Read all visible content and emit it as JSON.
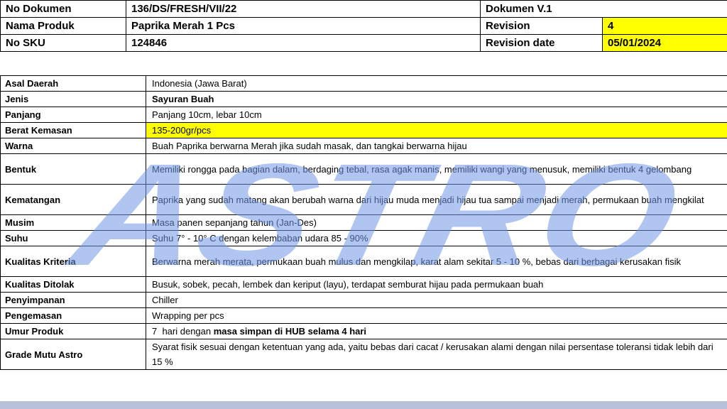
{
  "header": {
    "no_dokumen_label": "No Dokumen",
    "no_dokumen_value": "136/DS/FRESH/VII/22",
    "dokumen_version": "Dokumen V.1",
    "nama_produk_label": "Nama Produk",
    "nama_produk_value": "Paprika Merah 1 Pcs",
    "revision_label": "Revision",
    "revision_value": "4",
    "no_sku_label": "No SKU",
    "no_sku_value": "124846",
    "revision_date_label": "Revision date",
    "revision_date_value": "05/01/2024"
  },
  "spec": {
    "asal_daerah": {
      "label": "Asal Daerah",
      "value": "Indonesia (Jawa Barat)"
    },
    "jenis": {
      "label": "Jenis",
      "value": "Sayuran Buah"
    },
    "panjang": {
      "label": "Panjang",
      "value": "Panjang 10cm, lebar 10cm"
    },
    "berat_kemasan": {
      "label": "Berat Kemasan",
      "value": "135-200gr/pcs"
    },
    "warna": {
      "label": "Warna",
      "value": "Buah Paprika berwarna Merah jika sudah masak, dan tangkai berwarna  hijau"
    },
    "bentuk": {
      "label": "Bentuk",
      "value": "Memiliki rongga pada bagian dalam, berdaging tebal, rasa agak manis, memiliki wangi yang menusuk, memiliki bentuk  4 gelombang"
    },
    "kematangan": {
      "label": "Kematangan",
      "value": "Paprika yang sudah matang akan berubah warna dari hijau muda menjadi hijau tua sampai menjadi merah, permukaan buah mengkilat"
    },
    "musim": {
      "label": "Musim",
      "value": "Masa panen sepanjang tahun (Jan-Des)"
    },
    "suhu": {
      "label": "Suhu",
      "value": "Suhu 7° - 10° C dengan kelembaban udara 85 - 90%"
    },
    "kualitas_kriteria": {
      "label": "Kualitas Kriteria",
      "value": "Berwarna merah merata, permukaan buah mulus dan mengkilap, karat alam sekitar 5 - 10 %, bebas dari berbagai kerusakan fisik"
    },
    "kualitas_ditolak": {
      "label": "Kualitas Ditolak",
      "value": "Busuk, sobek, pecah, lembek dan keriput (layu), terdapat semburat hijau pada permukaan buah"
    },
    "penyimpanan": {
      "label": "Penyimpanan",
      "value": "Chiller"
    },
    "pengemasan": {
      "label": "Pengemasan",
      "value": "Wrapping per pcs"
    },
    "umur_produk": {
      "label": "Umur Produk",
      "value_prefix": "7  hari dengan ",
      "value_bold": "masa simpan di HUB selama 4 hari"
    },
    "grade_mutu": {
      "label": "Grade Mutu Astro",
      "value": "Syarat fisik sesuai dengan ketentuan yang ada, yaitu bebas dari cacat / kerusakan alami dengan  nilai persentase toleransi tidak lebih dari 15 %"
    }
  },
  "watermark": {
    "text": "ASTRO",
    "color": "#6f97e3"
  },
  "colors": {
    "highlight": "#ffff00",
    "bottom_bar": "#b7c0d6"
  }
}
